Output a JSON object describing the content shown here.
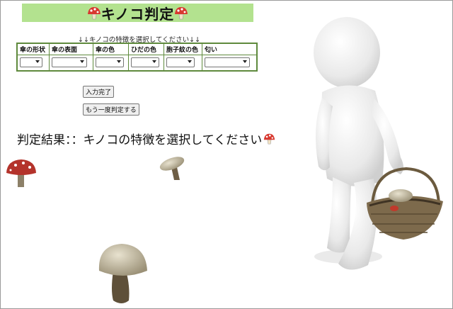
{
  "header": {
    "title": "キノコ判定",
    "icon": "mushroom-icon"
  },
  "form": {
    "prompt": "↓↓キノコの特徴を選択してください↓↓",
    "columns": [
      {
        "label": "傘の形状",
        "value": ""
      },
      {
        "label": "傘の表面",
        "value": ""
      },
      {
        "label": "傘の色",
        "value": ""
      },
      {
        "label": "ひだの色",
        "value": ""
      },
      {
        "label": "胞子紋の色",
        "value": ""
      },
      {
        "label": "匂い",
        "value": ""
      }
    ]
  },
  "buttons": {
    "submit": "入力完了",
    "retry": "もう一度判定する"
  },
  "result": {
    "label": "判定結果：：キノコの特徴を選択してください",
    "icon": "mushroom-icon"
  },
  "colors": {
    "title_bg": "#b3e28f",
    "table_border": "#5f8a3d",
    "mushroom_red": "#c0392b"
  }
}
